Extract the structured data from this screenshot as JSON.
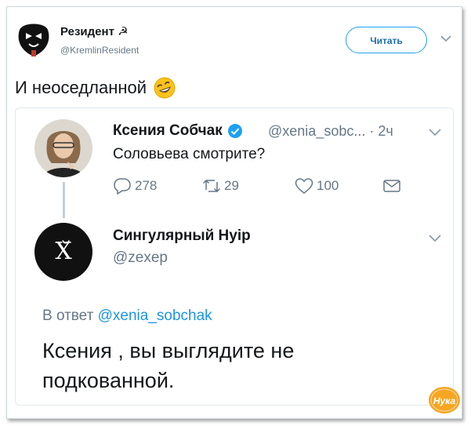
{
  "header": {
    "name": "Резидент ☭",
    "handle": "@KremlinResident",
    "follow_label": "Читать"
  },
  "tweet": {
    "text": "И неоседланной"
  },
  "quoted": {
    "name": "Ксения Собчак",
    "handle": "@xenia_sobc...",
    "time": "· 2ч",
    "text": "Соловьева смотрите?",
    "replies": "278",
    "retweets": "29",
    "likes": "100"
  },
  "reply": {
    "name": "Сингулярный Hyip",
    "handle": "@zexep",
    "avatar_letter": "Х̆",
    "reply_prefix": "В ответ",
    "reply_mention": "@xenia_sobchak",
    "text": "Ксения , вы выглядите не подкованной."
  },
  "watermark": {
    "text": "Нука"
  },
  "colors": {
    "accent": "#1da1f2",
    "link": "#1b95e0",
    "muted": "#657786",
    "watermark": "#f5a623"
  }
}
